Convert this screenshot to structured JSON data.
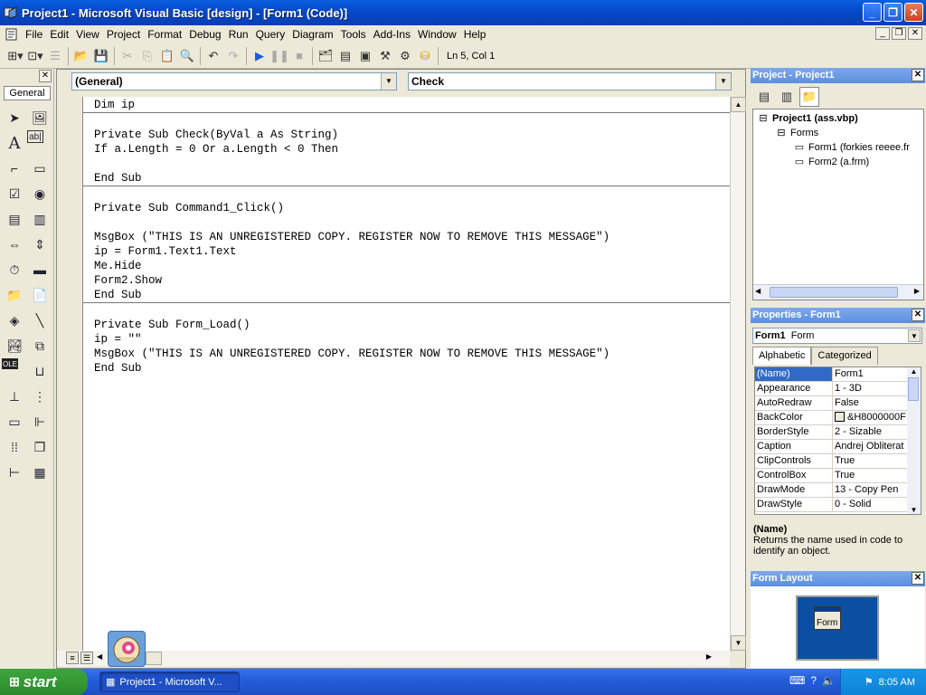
{
  "window": {
    "title": "Project1 - Microsoft Visual Basic [design] - [Form1 (Code)]",
    "minimize": "_",
    "restore": "❐",
    "close": "✕"
  },
  "menu": [
    "File",
    "Edit",
    "View",
    "Project",
    "Format",
    "Debug",
    "Run",
    "Query",
    "Diagram",
    "Tools",
    "Add-Ins",
    "Window",
    "Help"
  ],
  "toolbar": {
    "position": "Ln 5, Col 1"
  },
  "toolbox": {
    "tab": "General",
    "close": "✕"
  },
  "code": {
    "object_combo": "(General)",
    "proc_combo": "Check",
    "blocks": [
      [
        "Dim ip"
      ],
      [
        "",
        "Private Sub Check(ByVal a As String)",
        "If a.Length = 0 Or a.Length < 0 Then",
        "",
        "End Sub"
      ],
      [
        "",
        "Private Sub Command1_Click()",
        "",
        "MsgBox (\"THIS IS AN UNREGISTERED COPY. REGISTER NOW TO REMOVE THIS MESSAGE\")",
        "ip = Form1.Text1.Text",
        "Me.Hide",
        "Form2.Show",
        "End Sub"
      ],
      [
        "",
        "Private Sub Form_Load()",
        "ip = \"\"",
        "MsgBox (\"THIS IS AN UNREGISTERED COPY. REGISTER NOW TO REMOVE THIS MESSAGE\")",
        "End Sub"
      ]
    ]
  },
  "project": {
    "title": "Project - Project1",
    "tree": [
      {
        "label": "Project1 (ass.vbp)",
        "level": 0,
        "bold": true
      },
      {
        "label": "Forms",
        "level": 1,
        "bold": false
      },
      {
        "label": "Form1 (forkies reeee.fr",
        "level": 2,
        "bold": false
      },
      {
        "label": "Form2 (a.frm)",
        "level": 2,
        "bold": false
      }
    ]
  },
  "properties": {
    "title": "Properties - Form1",
    "object_name": "Form1",
    "object_type": "Form",
    "tabs": [
      "Alphabetic",
      "Categorized"
    ],
    "rows": [
      {
        "name": "(Name)",
        "value": "Form1"
      },
      {
        "name": "Appearance",
        "value": "1 - 3D"
      },
      {
        "name": "AutoRedraw",
        "value": "False"
      },
      {
        "name": "BackColor",
        "value": "&H8000000F"
      },
      {
        "name": "BorderStyle",
        "value": "2 - Sizable"
      },
      {
        "name": "Caption",
        "value": "Andrej Obliterat"
      },
      {
        "name": "ClipControls",
        "value": "True"
      },
      {
        "name": "ControlBox",
        "value": "True"
      },
      {
        "name": "DrawMode",
        "value": "13 - Copy Pen"
      },
      {
        "name": "DrawStyle",
        "value": "0 - Solid"
      }
    ],
    "desc_title": "(Name)",
    "desc_text": "Returns the name used in code to identify an object."
  },
  "form_layout": {
    "title": "Form Layout",
    "form_label": "Form"
  },
  "taskbar": {
    "start": "start",
    "task": "Project1 - Microsoft V...",
    "clock": "8:05 AM"
  }
}
